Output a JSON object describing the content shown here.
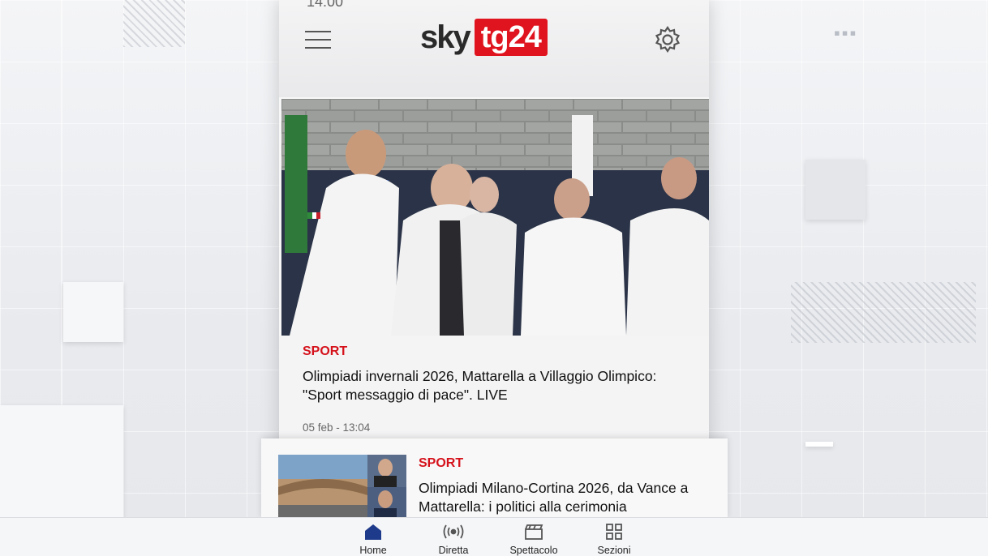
{
  "status_bar": {
    "time": "14:00"
  },
  "header": {
    "logo_primary": "sky",
    "logo_secondary": "tg24",
    "brand_color": "#e0141e"
  },
  "main_article": {
    "category": "SPORT",
    "title": "Olimpiadi invernali 2026, Mattarella a Villaggio Olimpico: \"Sport messaggio di pace\". LIVE",
    "date": "05 feb - 13:04"
  },
  "second_article": {
    "category": "SPORT",
    "title": "Olimpiadi Milano-Cortina 2026, da Vance a Mattarella: i politici alla cerimonia"
  },
  "bottom_nav": {
    "items": [
      {
        "label": "Home",
        "icon": "home-icon",
        "active": true
      },
      {
        "label": "Diretta",
        "icon": "broadcast-icon"
      },
      {
        "label": "Spettacolo",
        "icon": "clapperboard-icon"
      },
      {
        "label": "Sezioni",
        "icon": "grid-icon"
      }
    ],
    "active_color": "#1e3a8a"
  }
}
